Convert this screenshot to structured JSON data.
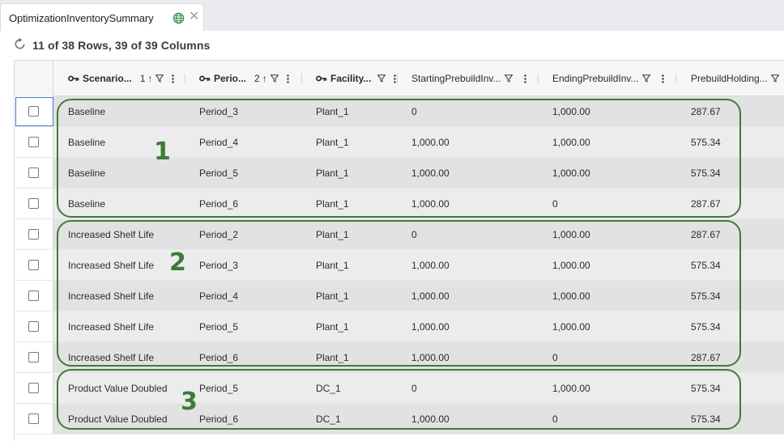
{
  "tab": {
    "label": "OptimizationInventorySummary",
    "globe_icon": "globe-icon",
    "close_glyph": "✕"
  },
  "summary": {
    "text": "11 of 38 Rows, 39 of 39 Columns",
    "refresh_icon": "refresh-icon"
  },
  "columns": [
    {
      "label": "Scenario...",
      "key": true,
      "sort_order": "1",
      "sort_arrow": "↑"
    },
    {
      "label": "Perio...",
      "key": true,
      "sort_order": "2",
      "sort_arrow": "↑"
    },
    {
      "label": "Facility...",
      "key": true
    },
    {
      "label": "StartingPrebuildInv...",
      "key": false
    },
    {
      "label": "EndingPrebuildInv...",
      "key": false
    },
    {
      "label": "PrebuildHolding...",
      "key": false
    }
  ],
  "rows": [
    [
      "Baseline",
      "Period_3",
      "Plant_1",
      "0",
      "1,000.00",
      "287.67"
    ],
    [
      "Baseline",
      "Period_4",
      "Plant_1",
      "1,000.00",
      "1,000.00",
      "575.34"
    ],
    [
      "Baseline",
      "Period_5",
      "Plant_1",
      "1,000.00",
      "1,000.00",
      "575.34"
    ],
    [
      "Baseline",
      "Period_6",
      "Plant_1",
      "1,000.00",
      "0",
      "287.67"
    ],
    [
      "Increased Shelf Life",
      "Period_2",
      "Plant_1",
      "0",
      "1,000.00",
      "287.67"
    ],
    [
      "Increased Shelf Life",
      "Period_3",
      "Plant_1",
      "1,000.00",
      "1,000.00",
      "575.34"
    ],
    [
      "Increased Shelf Life",
      "Period_4",
      "Plant_1",
      "1,000.00",
      "1,000.00",
      "575.34"
    ],
    [
      "Increased Shelf Life",
      "Period_5",
      "Plant_1",
      "1,000.00",
      "1,000.00",
      "575.34"
    ],
    [
      "Increased Shelf Life",
      "Period_6",
      "Plant_1",
      "1,000.00",
      "0",
      "287.67"
    ],
    [
      "Product Value Doubled",
      "Period_5",
      "DC_1",
      "0",
      "1,000.00",
      "575.34"
    ],
    [
      "Product Value Doubled",
      "Period_6",
      "DC_1",
      "1,000.00",
      "0",
      "575.34"
    ]
  ],
  "groups": [
    {
      "label": "1"
    },
    {
      "label": "2"
    },
    {
      "label": "3"
    }
  ],
  "colors": {
    "annotation": "#3f7a3b",
    "row_shade": "#e2e2e2",
    "header_bg": "#f5f6f8"
  }
}
